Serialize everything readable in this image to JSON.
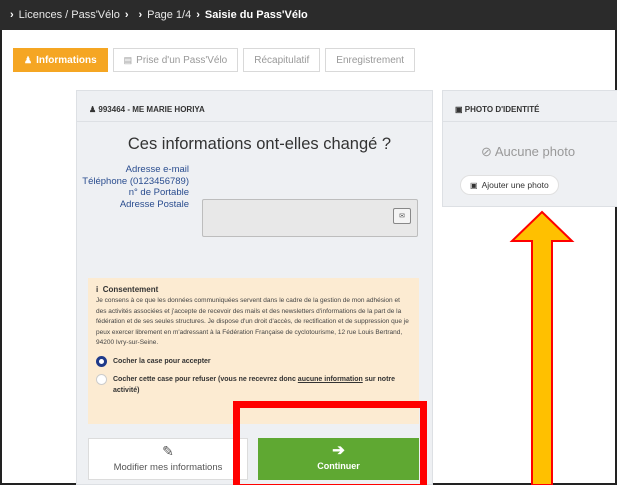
{
  "breadcrumb": {
    "items": [
      "Licences / Pass'Vélo",
      "",
      "Page 1/4"
    ],
    "current": "Saisie du Pass'Vélo"
  },
  "steps": [
    {
      "label": "Informations",
      "icon": "user-icon",
      "active": true
    },
    {
      "label": "Prise d'un Pass'Vélo",
      "icon": "card-icon",
      "active": false
    },
    {
      "label": "Récapitulatif",
      "active": false
    },
    {
      "label": "Enregistrement",
      "active": false
    }
  ],
  "member": {
    "header": "993464 - ME MARIE HORIYA",
    "question": "Ces informations ont-elles changé ?",
    "fields": {
      "email": "Adresse e-mail",
      "phone": "Téléphone (0123456789)",
      "mobile": "n° de Portable",
      "address": "Adresse Postale"
    }
  },
  "consent": {
    "title": "Consentement",
    "text": "Je consens à ce que les données communiquées servent dans le cadre de la gestion de mon adhésion et des activités associées et j'accepte de recevoir des mails et des newsletters d'informations de la part de la fédération et de ses seules structures. Je dispose d'un droit d'accès, de rectification et de suppression que je peux exercer librement en m'adressant à la Fédération Française de cyclotourisme, 12 rue Louis Bertrand, 94200 Ivry-sur-Seine.",
    "accept_label": "Cocher la case pour accepter",
    "refuse_label_before": "Cocher cette case pour refuser (vous ne recevrez donc ",
    "refuse_label_link": "aucune information",
    "refuse_label_after": " sur notre activité)"
  },
  "buttons": {
    "modify": "Modifier mes informations",
    "continue": "Continuer"
  },
  "photo": {
    "header": "PHOTO D'IDENTITÉ",
    "none": "Aucune photo",
    "add": "Ajouter une photo"
  },
  "colors": {
    "accent": "#f5a623",
    "continue": "#5fa832",
    "highlight_red": "#ff0000",
    "arrow_fill": "#ffc000",
    "arrow_stroke": "#ff0000"
  }
}
